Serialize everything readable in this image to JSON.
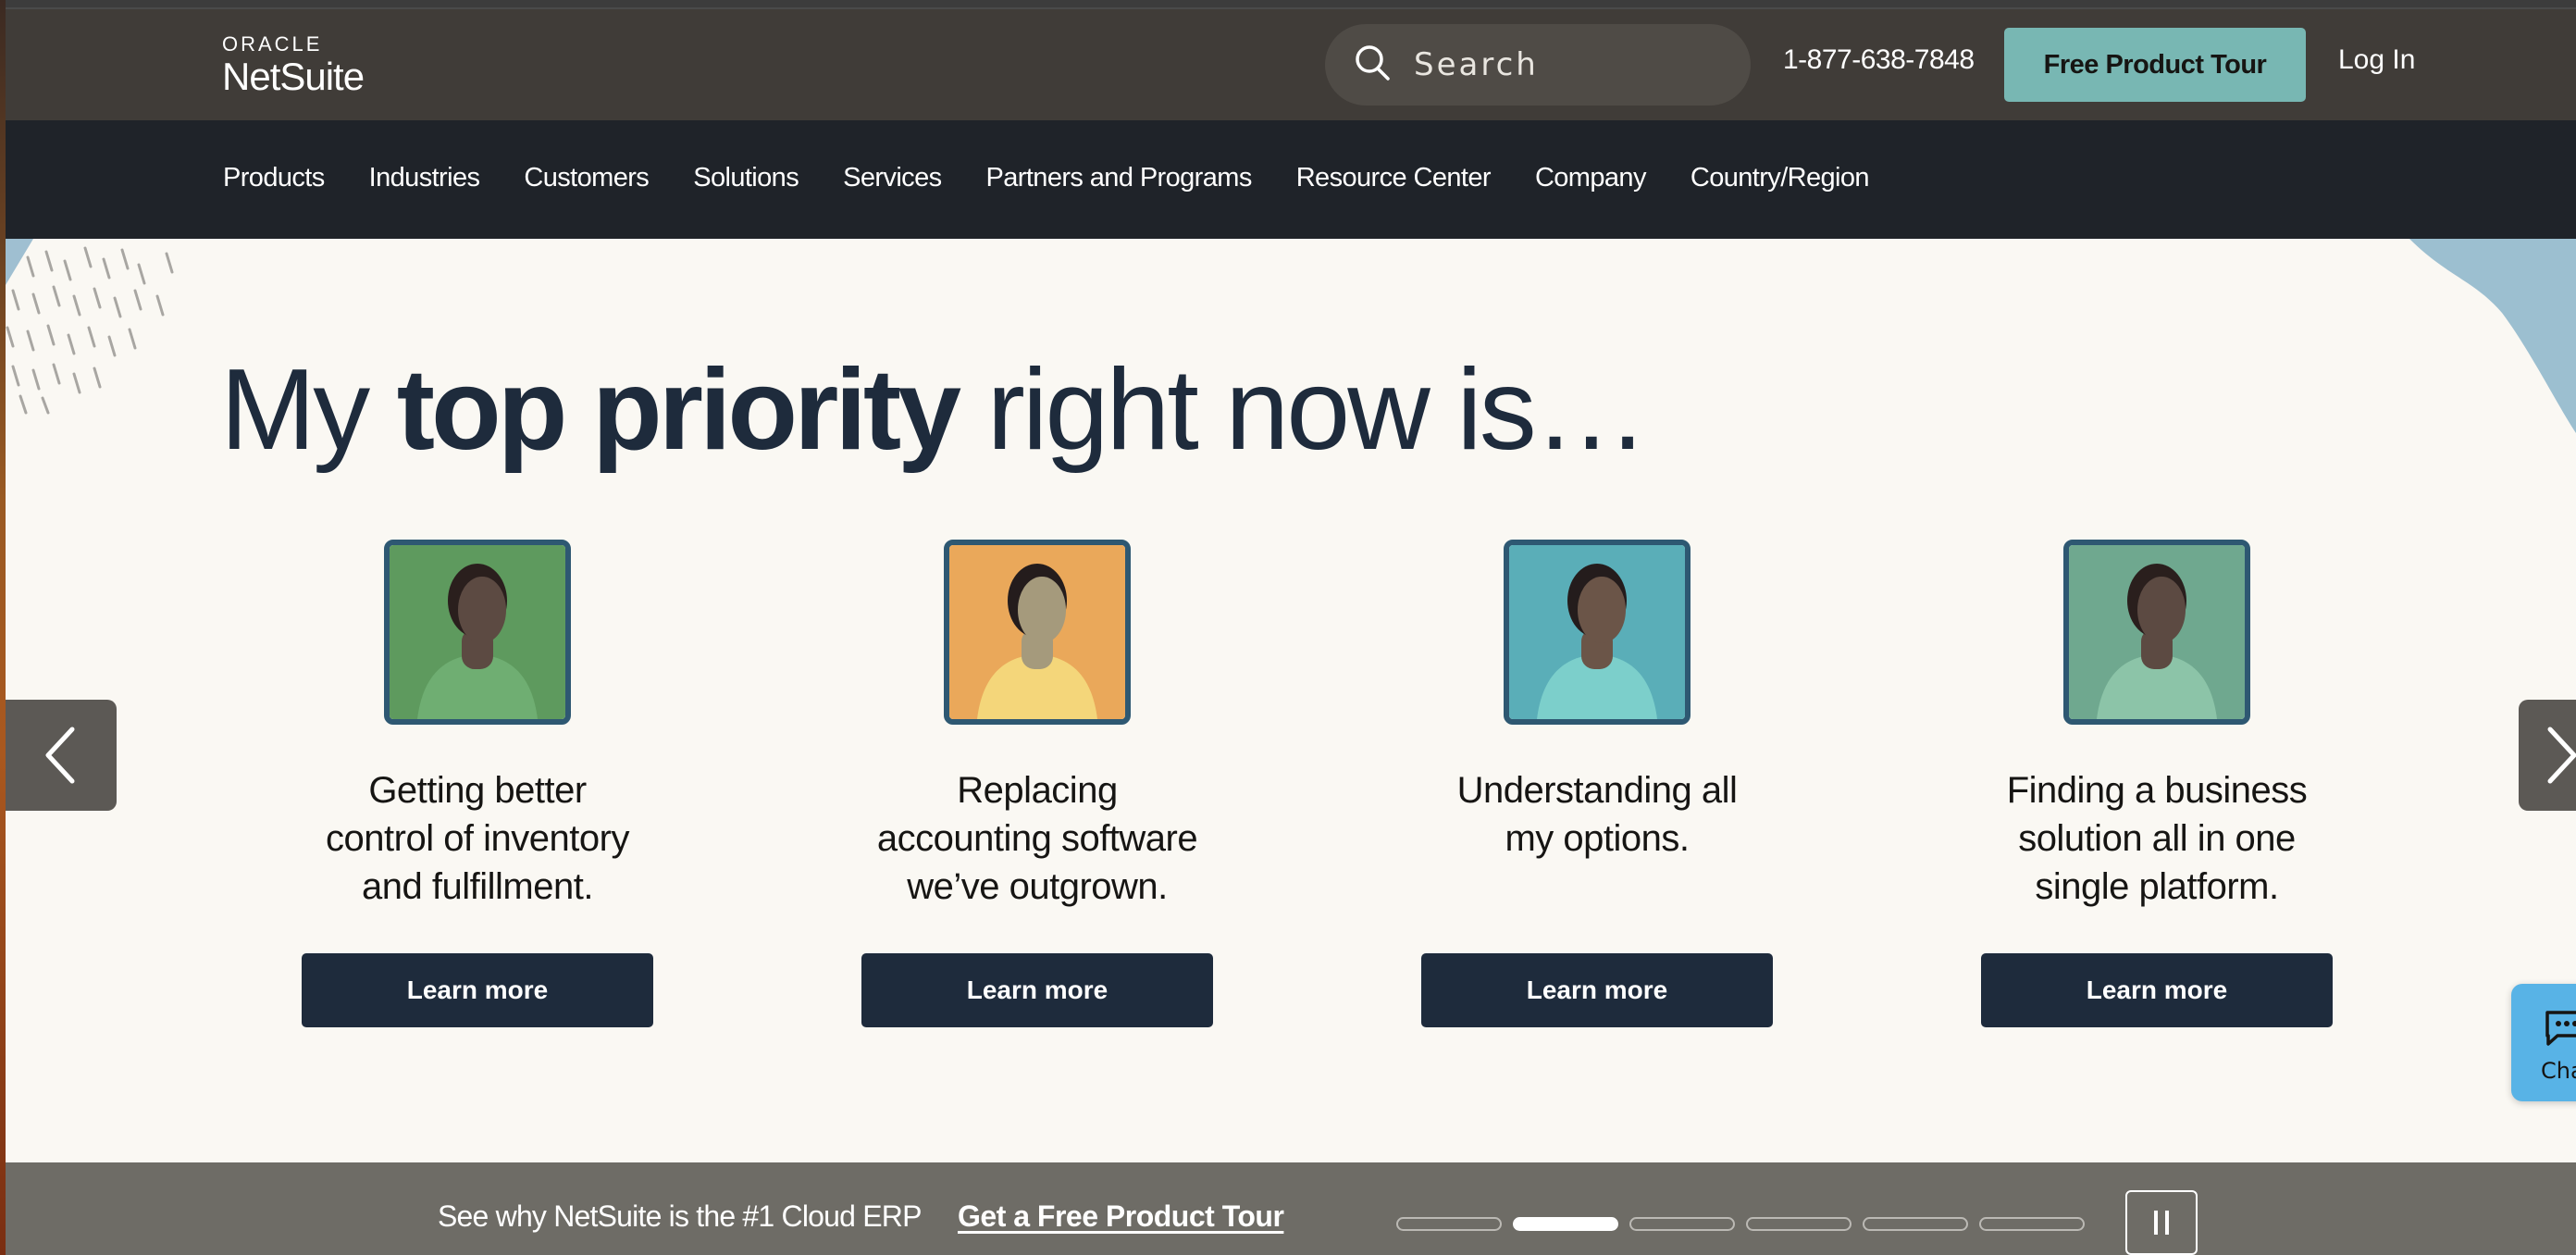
{
  "header": {
    "logo_top": "ORACLE",
    "logo_bottom": "NetSuite",
    "search_placeholder": "Search",
    "phone": "1-877-638-7848",
    "tour_button": "Free Product Tour",
    "login": "Log In"
  },
  "nav": {
    "items": [
      {
        "label": "Products"
      },
      {
        "label": "Industries"
      },
      {
        "label": "Customers"
      },
      {
        "label": "Solutions"
      },
      {
        "label": "Services"
      },
      {
        "label": "Partners and Programs"
      },
      {
        "label": "Resource Center"
      },
      {
        "label": "Company"
      },
      {
        "label": "Country/Region"
      }
    ]
  },
  "hero": {
    "title_pre": "My ",
    "title_bold": "top priority",
    "title_post": " right now is…",
    "cards": [
      {
        "lines": [
          "Getting better",
          "control of inventory",
          "and fulfillment."
        ],
        "button": "Learn more",
        "bg": "#5e9a5e",
        "shirt": "#6fae72",
        "skin": "#5c4a42",
        "hair": "#2a1f1d"
      },
      {
        "lines": [
          "Replacing",
          "accounting software",
          "we’ve outgrown."
        ],
        "button": "Learn more",
        "bg": "#eaa85a",
        "shirt": "#f4d67a",
        "skin": "#a59a7c",
        "hair": "#241c1c"
      },
      {
        "lines": [
          "Understanding all",
          "my options."
        ],
        "button": "Learn more",
        "bg": "#5aaeb8",
        "shirt": "#7ccfcb",
        "skin": "#6b5548",
        "hair": "#241c1c"
      },
      {
        "lines": [
          "Finding a business",
          "solution all in one",
          "single platform."
        ],
        "button": "Learn more",
        "bg": "#6fa88f",
        "shirt": "#8cc4a8",
        "skin": "#5c4a42",
        "hair": "#2a1f1d"
      }
    ],
    "prev_label": "Previous",
    "next_label": "Next"
  },
  "chat": {
    "label": "Chat"
  },
  "banner": {
    "text": "See why NetSuite is the #1 Cloud ERP",
    "link": "Get a Free Product Tour",
    "slide_count": 6,
    "active_slide": 2
  }
}
